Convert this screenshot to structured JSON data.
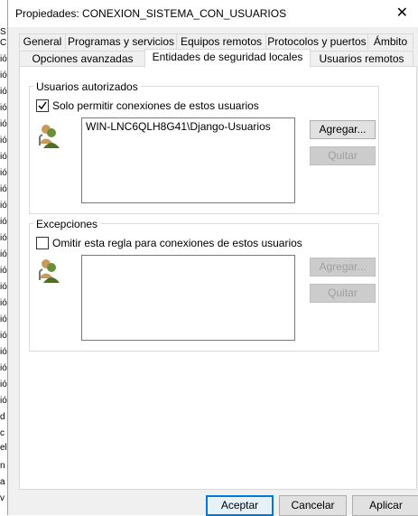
{
  "window": {
    "title": "Propiedades: CONEXION_SISTEMA_CON_USUARIOS",
    "close_glyph": "✕"
  },
  "background_chars": [
    "S",
    "C",
    "ió",
    "ió",
    "ió",
    "ió",
    "ió",
    "ió",
    "ió",
    "ió",
    "ió",
    "ió",
    "ió",
    "ió",
    "ió",
    "ió",
    "ió",
    "ió",
    "ió",
    "ió",
    "ió",
    "ió",
    "ió",
    "c",
    "el",
    "n",
    "a",
    "ió",
    "d",
    "v"
  ],
  "tabs_row1": [
    "General",
    "Programas y servicios",
    "Equipos remotos",
    "Protocolos y puertos",
    "Ámbito"
  ],
  "tabs_row2": [
    "Opciones avanzadas",
    "Entidades de seguridad locales",
    "Usuarios remotos"
  ],
  "authorized": {
    "group_label": "Usuarios autorizados",
    "checkbox_label": "Solo permitir conexiones de estos usuarios",
    "checked": true,
    "items": [
      "WIN-LNC6QLH8G41\\Django-Usuarios"
    ],
    "add_label": "Agregar...",
    "remove_label": "Quitar"
  },
  "exceptions": {
    "group_label": "Excepciones",
    "checkbox_label": "Omitir esta regla para conexiones de estos usuarios",
    "checked": false,
    "items": [],
    "add_label": "Agregar...",
    "remove_label": "Quitar"
  },
  "footer": {
    "ok_label": "Aceptar",
    "cancel_label": "Cancelar",
    "apply_label": "Aplicar"
  },
  "icons": {
    "users": "users-icon",
    "close": "close-icon",
    "check": "check-icon"
  },
  "colors": {
    "primary_border": "#0078d7",
    "disabled_text": "#a0a0a0"
  }
}
